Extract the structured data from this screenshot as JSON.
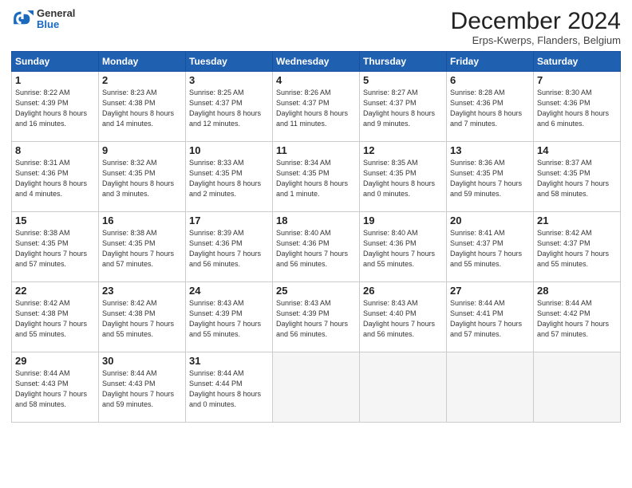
{
  "header": {
    "logo_general": "General",
    "logo_blue": "Blue",
    "month_title": "December 2024",
    "subtitle": "Erps-Kwerps, Flanders, Belgium"
  },
  "days_of_week": [
    "Sunday",
    "Monday",
    "Tuesday",
    "Wednesday",
    "Thursday",
    "Friday",
    "Saturday"
  ],
  "weeks": [
    [
      {
        "day": "1",
        "sunrise": "8:22 AM",
        "sunset": "4:39 PM",
        "daylight": "8 hours and 16 minutes."
      },
      {
        "day": "2",
        "sunrise": "8:23 AM",
        "sunset": "4:38 PM",
        "daylight": "8 hours and 14 minutes."
      },
      {
        "day": "3",
        "sunrise": "8:25 AM",
        "sunset": "4:37 PM",
        "daylight": "8 hours and 12 minutes."
      },
      {
        "day": "4",
        "sunrise": "8:26 AM",
        "sunset": "4:37 PM",
        "daylight": "8 hours and 11 minutes."
      },
      {
        "day": "5",
        "sunrise": "8:27 AM",
        "sunset": "4:37 PM",
        "daylight": "8 hours and 9 minutes."
      },
      {
        "day": "6",
        "sunrise": "8:28 AM",
        "sunset": "4:36 PM",
        "daylight": "8 hours and 7 minutes."
      },
      {
        "day": "7",
        "sunrise": "8:30 AM",
        "sunset": "4:36 PM",
        "daylight": "8 hours and 6 minutes."
      }
    ],
    [
      {
        "day": "8",
        "sunrise": "8:31 AM",
        "sunset": "4:36 PM",
        "daylight": "8 hours and 4 minutes."
      },
      {
        "day": "9",
        "sunrise": "8:32 AM",
        "sunset": "4:35 PM",
        "daylight": "8 hours and 3 minutes."
      },
      {
        "day": "10",
        "sunrise": "8:33 AM",
        "sunset": "4:35 PM",
        "daylight": "8 hours and 2 minutes."
      },
      {
        "day": "11",
        "sunrise": "8:34 AM",
        "sunset": "4:35 PM",
        "daylight": "8 hours and 1 minute."
      },
      {
        "day": "12",
        "sunrise": "8:35 AM",
        "sunset": "4:35 PM",
        "daylight": "8 hours and 0 minutes."
      },
      {
        "day": "13",
        "sunrise": "8:36 AM",
        "sunset": "4:35 PM",
        "daylight": "7 hours and 59 minutes."
      },
      {
        "day": "14",
        "sunrise": "8:37 AM",
        "sunset": "4:35 PM",
        "daylight": "7 hours and 58 minutes."
      }
    ],
    [
      {
        "day": "15",
        "sunrise": "8:38 AM",
        "sunset": "4:35 PM",
        "daylight": "7 hours and 57 minutes."
      },
      {
        "day": "16",
        "sunrise": "8:38 AM",
        "sunset": "4:35 PM",
        "daylight": "7 hours and 57 minutes."
      },
      {
        "day": "17",
        "sunrise": "8:39 AM",
        "sunset": "4:36 PM",
        "daylight": "7 hours and 56 minutes."
      },
      {
        "day": "18",
        "sunrise": "8:40 AM",
        "sunset": "4:36 PM",
        "daylight": "7 hours and 56 minutes."
      },
      {
        "day": "19",
        "sunrise": "8:40 AM",
        "sunset": "4:36 PM",
        "daylight": "7 hours and 55 minutes."
      },
      {
        "day": "20",
        "sunrise": "8:41 AM",
        "sunset": "4:37 PM",
        "daylight": "7 hours and 55 minutes."
      },
      {
        "day": "21",
        "sunrise": "8:42 AM",
        "sunset": "4:37 PM",
        "daylight": "7 hours and 55 minutes."
      }
    ],
    [
      {
        "day": "22",
        "sunrise": "8:42 AM",
        "sunset": "4:38 PM",
        "daylight": "7 hours and 55 minutes."
      },
      {
        "day": "23",
        "sunrise": "8:42 AM",
        "sunset": "4:38 PM",
        "daylight": "7 hours and 55 minutes."
      },
      {
        "day": "24",
        "sunrise": "8:43 AM",
        "sunset": "4:39 PM",
        "daylight": "7 hours and 55 minutes."
      },
      {
        "day": "25",
        "sunrise": "8:43 AM",
        "sunset": "4:39 PM",
        "daylight": "7 hours and 56 minutes."
      },
      {
        "day": "26",
        "sunrise": "8:43 AM",
        "sunset": "4:40 PM",
        "daylight": "7 hours and 56 minutes."
      },
      {
        "day": "27",
        "sunrise": "8:44 AM",
        "sunset": "4:41 PM",
        "daylight": "7 hours and 57 minutes."
      },
      {
        "day": "28",
        "sunrise": "8:44 AM",
        "sunset": "4:42 PM",
        "daylight": "7 hours and 57 minutes."
      }
    ],
    [
      {
        "day": "29",
        "sunrise": "8:44 AM",
        "sunset": "4:43 PM",
        "daylight": "7 hours and 58 minutes."
      },
      {
        "day": "30",
        "sunrise": "8:44 AM",
        "sunset": "4:43 PM",
        "daylight": "7 hours and 59 minutes."
      },
      {
        "day": "31",
        "sunrise": "8:44 AM",
        "sunset": "4:44 PM",
        "daylight": "8 hours and 0 minutes."
      },
      null,
      null,
      null,
      null
    ]
  ]
}
